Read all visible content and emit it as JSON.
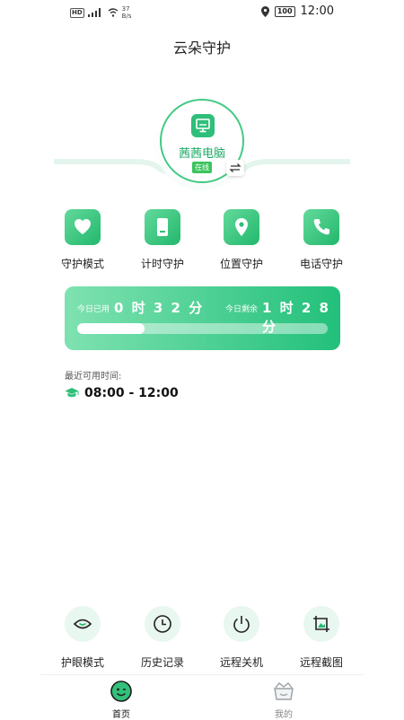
{
  "status_bar": {
    "network_badge": "HD",
    "speed_value": "37",
    "speed_unit": "B/s",
    "battery": "100",
    "time": "12:00"
  },
  "header": {
    "title": "云朵守护"
  },
  "device": {
    "name": "茜茜电脑",
    "status": "在线"
  },
  "features": [
    {
      "label": "守护模式",
      "icon": "heart-icon"
    },
    {
      "label": "计时守护",
      "icon": "phone-timer-icon"
    },
    {
      "label": "位置守护",
      "icon": "location-pin-icon"
    },
    {
      "label": "电话守护",
      "icon": "phone-call-icon"
    }
  ],
  "usage": {
    "used_label": "今日已用",
    "used_value": "0 时 3 2 分",
    "remaining_label": "今日剩余",
    "remaining_value": "1 时 2 8 分",
    "progress_fraction": 0.27
  },
  "available": {
    "label": "最近可用时间:",
    "time_range": "08:00 - 12:00",
    "icon": "graduation-cap-icon"
  },
  "tools": [
    {
      "label": "护眼模式",
      "icon": "eye-icon"
    },
    {
      "label": "历史记录",
      "icon": "clock-icon"
    },
    {
      "label": "远程关机",
      "icon": "power-icon"
    },
    {
      "label": "远程截图",
      "icon": "screenshot-icon"
    }
  ],
  "tabbar": {
    "home": "首页",
    "mine": "我的"
  },
  "colors": {
    "accent": "#22b86d",
    "accent_light": "#e8f7ef",
    "online": "#3bc45c"
  }
}
